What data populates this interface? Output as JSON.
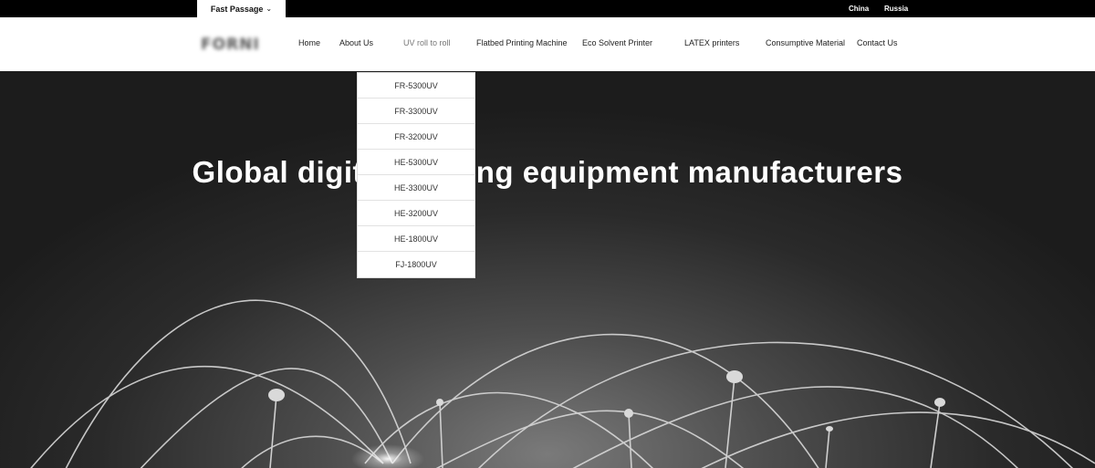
{
  "topbar": {
    "fast_passage": "Fast Passage",
    "fast_passage_chevron": "⌄",
    "languages": [
      "China",
      "Russia"
    ]
  },
  "header": {
    "logo_text": "FORNI",
    "nav": [
      {
        "label": "Home"
      },
      {
        "label": "About Us"
      },
      {
        "label": "UV roll to roll"
      },
      {
        "label": "Flatbed Printing Machine"
      },
      {
        "label": "Eco Solvent Printer"
      },
      {
        "label": "LATEX printers"
      },
      {
        "label": "Consumptive Material"
      },
      {
        "label": "Contact Us"
      }
    ]
  },
  "dropdown": {
    "items": [
      "FR-5300UV",
      "FR-3300UV",
      "FR-3200UV",
      "HE-5300UV",
      "HE-3300UV",
      "HE-3200UV",
      "HE-1800UV",
      "FJ-1800UV"
    ]
  },
  "hero": {
    "title": "Global digital printing equipment manufacturers"
  },
  "colors": {
    "topbar_bg": "#000000",
    "header_bg": "#ffffff",
    "hero_text": "#ffffff"
  }
}
